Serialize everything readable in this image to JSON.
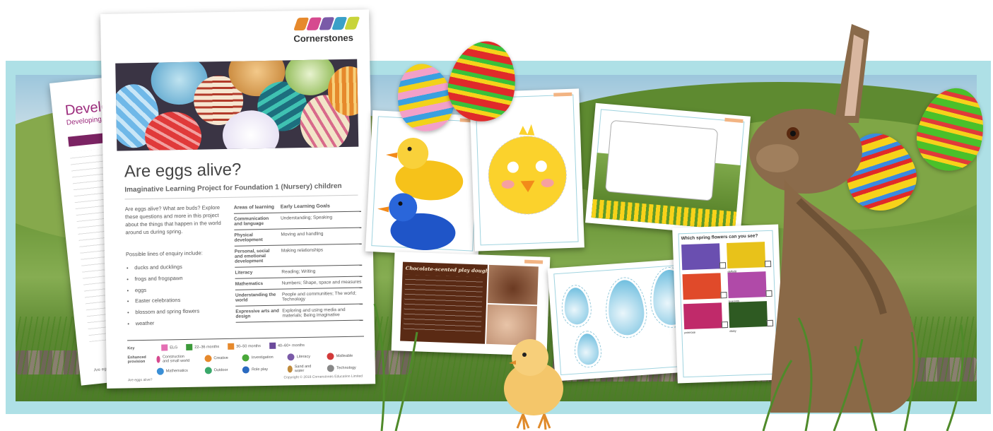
{
  "back_doc": {
    "heading": "Develop",
    "subheading": "Developing childre",
    "footer": "Are eggs alive?"
  },
  "main_doc": {
    "logo_text": "Cornerstones",
    "title": "Are eggs alive?",
    "subtitle": "Imaginative Learning Project for Foundation 1 (Nursery) children",
    "intro": "Are eggs alive? What are buds? Explore these questions and more in this project about the things that happen in the world around us during spring.",
    "lines_header": "Possible lines of enquiry include:",
    "enquiry_lines": [
      "ducks and ducklings",
      "frogs and frogspawn",
      "eggs",
      "Easter celebrations",
      "blossom and spring flowers",
      "weather"
    ],
    "table_headers": [
      "Areas of learning",
      "Early Learning Goals"
    ],
    "table_rows": [
      {
        "area": "Communication and language",
        "goals": "Understanding; Speaking"
      },
      {
        "area": "Physical development",
        "goals": "Moving and handling"
      },
      {
        "area": "Personal, social and emotional development",
        "goals": "Making relationships"
      },
      {
        "area": "Literacy",
        "goals": "Reading; Writing"
      },
      {
        "area": "Mathematics",
        "goals": "Numbers; Shape, space and measures"
      },
      {
        "area": "Understanding the world",
        "goals": "People and communities; The world; Technology"
      },
      {
        "area": "Expressive arts and design",
        "goals": "Exploring and using media and materials; Being imaginative"
      }
    ],
    "key_label": "Key",
    "key_items": [
      {
        "label": "ELG",
        "color": "#e46fb4"
      },
      {
        "label": "22–36 months",
        "color": "#3c9a3a"
      },
      {
        "label": "30–50 months",
        "color": "#e6892c"
      },
      {
        "label": "40–60+ months",
        "color": "#6b4a9b"
      }
    ],
    "enhanced_label": "Enhanced provision",
    "provision_items": [
      {
        "label": "Construction and small world",
        "color": "#d64a8f"
      },
      {
        "label": "Creative",
        "color": "#e6892c"
      },
      {
        "label": "Investigation",
        "color": "#4aa83a"
      },
      {
        "label": "Literacy",
        "color": "#7a5aa8"
      },
      {
        "label": "Malleable",
        "color": "#d23a3a"
      },
      {
        "label": "Mathematics",
        "color": "#3a8fd6"
      },
      {
        "label": "Outdoor",
        "color": "#3aa86a"
      },
      {
        "label": "Role play",
        "color": "#2a6ac0"
      },
      {
        "label": "Sand and water",
        "color": "#c08a3a"
      },
      {
        "label": "Technology",
        "color": "#888888"
      }
    ],
    "footer_left": "Are eggs alive?",
    "footer_right": "Copyright © 2018  Cornerstones Education Limited"
  },
  "choc_card": {
    "title": "Chocolate-scented play dough"
  },
  "flower_card": {
    "title": "Which spring flowers can you see?",
    "captions": [
      "",
      "daffodil",
      "",
      "hyacinth",
      "primrose",
      "daisy"
    ]
  },
  "colors": {
    "frame": "#aee0e6",
    "accent_purple": "#9b2a7c",
    "card_border": "#9fd3df"
  }
}
